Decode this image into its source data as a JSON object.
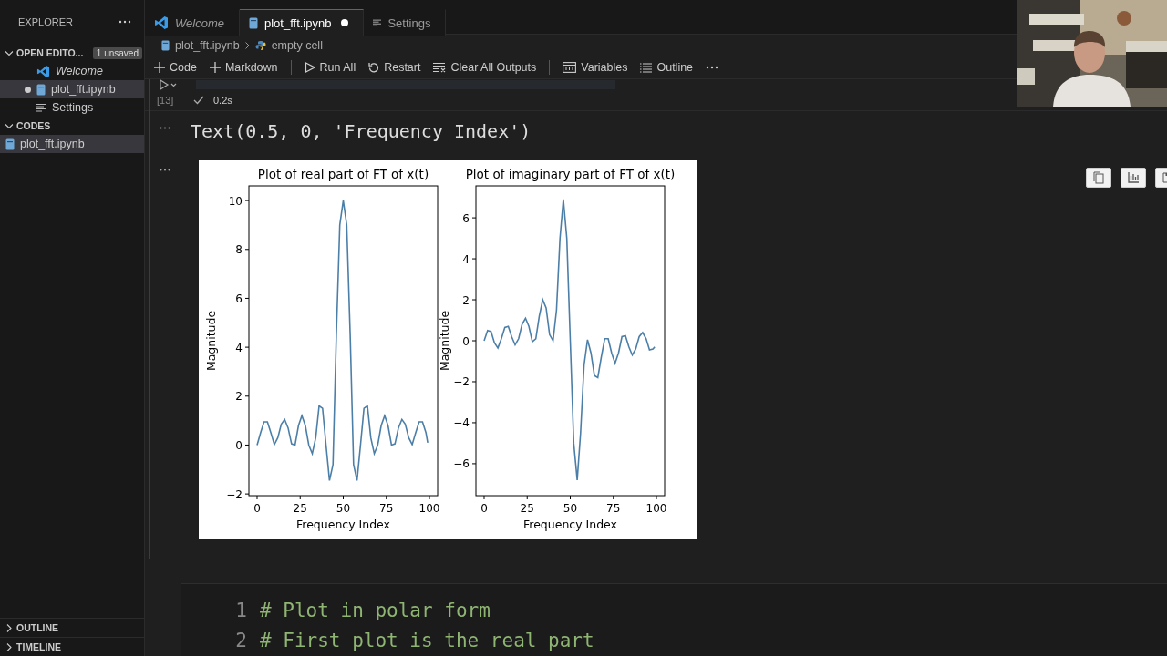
{
  "sidebar": {
    "title": "EXPLORER",
    "sections": [
      {
        "label": "OPEN EDITO...",
        "expanded": true,
        "badge": "1 unsaved",
        "items": [
          {
            "label": "Welcome",
            "kind": "welcome",
            "preview": true,
            "unsaved": false,
            "selected": false
          },
          {
            "label": "plot_fft.ipynb",
            "kind": "notebook",
            "preview": false,
            "unsaved": true,
            "selected": true
          },
          {
            "label": "Settings",
            "kind": "settings",
            "preview": false,
            "unsaved": false,
            "selected": false
          }
        ]
      },
      {
        "label": "CODES",
        "expanded": true,
        "items": [
          {
            "label": "plot_fft.ipynb",
            "kind": "notebook",
            "preview": false,
            "selected": true
          }
        ]
      }
    ],
    "bottom_panels": [
      {
        "label": "OUTLINE",
        "expanded": false
      },
      {
        "label": "TIMELINE",
        "expanded": false
      }
    ]
  },
  "tabs": [
    {
      "label": "Welcome",
      "kind": "welcome",
      "preview": true,
      "unsaved": false,
      "selected": false
    },
    {
      "label": "plot_fft.ipynb",
      "kind": "notebook",
      "preview": false,
      "unsaved": true,
      "selected": true
    },
    {
      "label": "Settings",
      "kind": "settings",
      "preview": false,
      "unsaved": false,
      "selected": false
    }
  ],
  "breadcrumb": [
    {
      "label": "plot_fft.ipynb",
      "kind": "notebook"
    },
    {
      "label": "empty cell",
      "kind": "cell"
    }
  ],
  "toolbar": [
    [
      {
        "label": "Code",
        "kind": "add"
      },
      {
        "label": "Markdown",
        "kind": "add"
      }
    ],
    [
      {
        "label": "Run All",
        "kind": "run"
      },
      {
        "label": "Restart",
        "kind": "restart"
      },
      {
        "label": "Clear All Outputs",
        "kind": "clear"
      }
    ],
    [
      {
        "label": "Variables",
        "kind": "variables"
      },
      {
        "label": "Outline",
        "kind": "outline"
      }
    ]
  ],
  "cell": {
    "execution_count": "[13]",
    "succeeded": true,
    "duration": "0.2s",
    "output_text": "Text(0.5, 0, 'Frequency Index')",
    "charts": [
      {
        "chart_data": {
          "type": "line",
          "title": "Plot of real part of FT of x(t)",
          "xlabel": "Frequency Index",
          "ylabel": "Magnitude",
          "x": [
            0,
            2,
            4,
            6,
            8,
            10,
            12,
            14,
            16,
            18,
            20,
            22,
            24,
            26,
            28,
            30,
            32,
            34,
            36,
            38,
            40,
            42,
            44,
            46,
            48,
            50,
            52,
            54,
            56,
            58,
            60,
            62,
            64,
            66,
            68,
            70,
            72,
            74,
            76,
            78,
            80,
            82,
            84,
            86,
            88,
            90,
            92,
            94,
            96,
            98,
            99
          ],
          "series": [
            {
              "color": "#4c7fa8",
              "values": [
                0,
                0.5,
                0.95,
                0.95,
                0.5,
                0.02,
                0.3,
                0.85,
                1.05,
                0.7,
                0.05,
                0.0,
                0.8,
                1.2,
                0.8,
                0.0,
                -0.35,
                0.3,
                1.6,
                1.5,
                0.0,
                -1.45,
                -0.8,
                4.5,
                9.0,
                10.0,
                9.0,
                4.5,
                -0.8,
                -1.45,
                0.0,
                1.5,
                1.6,
                0.3,
                -0.35,
                0.0,
                0.8,
                1.2,
                0.8,
                0.0,
                0.05,
                0.7,
                1.05,
                0.85,
                0.3,
                0.02,
                0.5,
                0.95,
                0.95,
                0.5,
                0.1
              ]
            }
          ],
          "xlim": [
            -4.76,
            104.76
          ],
          "ylim": [
            -2.07,
            10.6
          ],
          "xticks": [
            0,
            25,
            50,
            75,
            100
          ],
          "yticks": [
            {
              "value": -2,
              "label": "−2"
            },
            0,
            2,
            4,
            6,
            8,
            10
          ]
        }
      },
      {
        "chart_data": {
          "type": "line",
          "title": "Plot of imaginary part of FT of x(t)",
          "xlabel": "Frequency Index",
          "ylabel": "Magnitude",
          "x": [
            0,
            2,
            4,
            6,
            8,
            10,
            12,
            14,
            16,
            18,
            20,
            22,
            24,
            26,
            28,
            30,
            32,
            34,
            36,
            38,
            40,
            42,
            44,
            46,
            48,
            50,
            52,
            54,
            56,
            58,
            60,
            62,
            64,
            66,
            68,
            70,
            72,
            74,
            76,
            78,
            80,
            82,
            84,
            86,
            88,
            90,
            92,
            94,
            96,
            98,
            99
          ],
          "series": [
            {
              "color": "#4c7fa8",
              "values": [
                0,
                0.5,
                0.45,
                -0.1,
                -0.35,
                0.1,
                0.65,
                0.7,
                0.2,
                -0.2,
                0.1,
                0.8,
                1.1,
                0.7,
                -0.05,
                0.1,
                1.2,
                2.0,
                1.6,
                0.3,
                0.0,
                1.5,
                5.0,
                6.9,
                5.0,
                0.0,
                -5.0,
                -6.8,
                -4.5,
                -1.2,
                0.05,
                -0.6,
                -1.7,
                -1.8,
                -0.8,
                0.1,
                0.1,
                -0.6,
                -1.1,
                -0.6,
                0.2,
                0.25,
                -0.3,
                -0.7,
                -0.4,
                0.2,
                0.4,
                0.1,
                -0.45,
                -0.4,
                -0.3
              ]
            }
          ],
          "xlim": [
            -4.76,
            104.76
          ],
          "ylim": [
            -7.56,
            7.56
          ],
          "xticks": [
            0,
            25,
            50,
            75,
            100
          ],
          "yticks": [
            {
              "value": -6,
              "label": "−6"
            },
            {
              "value": -4,
              "label": "−4"
            },
            {
              "value": -2,
              "label": "−2"
            },
            0,
            2,
            4,
            6
          ]
        }
      }
    ]
  },
  "next_cell": {
    "lines": [
      {
        "number": "1",
        "text": "# Plot in polar form"
      },
      {
        "number": "2",
        "text": "# First plot is the real part"
      }
    ]
  },
  "webcam": {
    "kind": "picture"
  }
}
